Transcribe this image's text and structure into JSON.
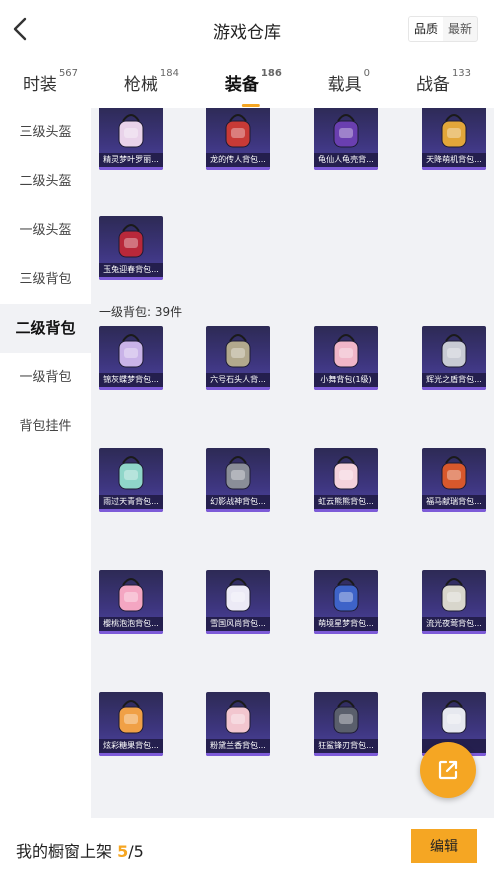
{
  "header": {
    "title": "游戏仓库",
    "sort_options": [
      "品质",
      "最新"
    ],
    "sort_active": 0
  },
  "categories": [
    {
      "label": "时装",
      "count": "567",
      "active": false
    },
    {
      "label": "枪械",
      "count": "184",
      "active": false
    },
    {
      "label": "装备",
      "count": "186",
      "active": true
    },
    {
      "label": "载具",
      "count": "0",
      "active": false
    },
    {
      "label": "战备",
      "count": "133",
      "active": false
    }
  ],
  "sidebar": {
    "items": [
      {
        "label": "三级头盔",
        "active": false
      },
      {
        "label": "二级头盔",
        "active": false
      },
      {
        "label": "一级头盔",
        "active": false
      },
      {
        "label": "三级背包",
        "active": false
      },
      {
        "label": "二级背包",
        "active": true
      },
      {
        "label": "一级背包",
        "active": false
      },
      {
        "label": "背包挂件",
        "active": false
      }
    ]
  },
  "sections": {
    "level2_items": [
      {
        "name": "精灵梦叶罗丽...",
        "icon": "pink-backpack-icon",
        "color": "#e9d3ea"
      },
      {
        "name": "龙的传人背包...",
        "icon": "red-backpack-icon",
        "color": "#c83a36"
      },
      {
        "name": "龟仙人龟壳背...",
        "icon": "purple-shell-backpack-icon",
        "color": "#6a3fb0"
      },
      {
        "name": "天降萌机背包...",
        "icon": "gold-backpack-icon",
        "color": "#e2a63a"
      },
      {
        "name": "玉兔迎春背包...",
        "icon": "red-white-backpack-icon",
        "color": "#b8283a"
      }
    ],
    "level1_label": "一级背包: 39件",
    "level1_items": [
      {
        "name": "锦灰蝶梦背包...",
        "icon": "gem-pouch-icon",
        "color": "#c9b3e8"
      },
      {
        "name": "六号石头人背...",
        "icon": "stone-pouch-icon",
        "color": "#b2a98d"
      },
      {
        "name": "小舞背包(1级)",
        "icon": "bunny-pouch-icon",
        "color": "#f0b6c8"
      },
      {
        "name": "辉光之盾背包...",
        "icon": "shield-pouch-icon",
        "color": "#c8cbd4"
      },
      {
        "name": "雨过天青背包...",
        "icon": "teal-pouch-icon",
        "color": "#8fd6c9"
      },
      {
        "name": "幻影战神背包...",
        "icon": "grey-backpack-icon",
        "color": "#8a8e98"
      },
      {
        "name": "虹云熊熊背包...",
        "icon": "cloud-bear-pouch-icon",
        "color": "#f4d2dc"
      },
      {
        "name": "福马献瑞背包...",
        "icon": "horse-pouch-icon",
        "color": "#d8582c"
      },
      {
        "name": "樱桃泡泡背包...",
        "icon": "cherry-pouch-icon",
        "color": "#f4a6c2"
      },
      {
        "name": "雪国风尚背包...",
        "icon": "snow-bunny-pouch-icon",
        "color": "#eceaf6"
      },
      {
        "name": "萌境星梦背包...",
        "icon": "star-pouch-icon",
        "color": "#3e63c8"
      },
      {
        "name": "流光夜莺背包...",
        "icon": "nightingale-pouch-icon",
        "color": "#d8d6cc"
      },
      {
        "name": "炫彩糖果背包...",
        "icon": "donut-pouch-icon",
        "color": "#f0a046"
      },
      {
        "name": "粉黛兰香背包...",
        "icon": "pink-bunny-pouch-icon",
        "color": "#f2c6cf"
      },
      {
        "name": "狂鲨锋刃背包...",
        "icon": "shark-pouch-icon",
        "color": "#5a5f6c"
      },
      {
        "name": "",
        "icon": "white-pouch-icon",
        "color": "#e6e8ef"
      }
    ]
  },
  "bottom": {
    "label": "我的橱窗上架 ",
    "count_current": "5",
    "count_sep": "/",
    "count_total": "5",
    "edit_label": "编辑"
  },
  "fab_icon": "share-external-icon",
  "colors": {
    "accent": "#f5a623",
    "card_bg": "#3e3680",
    "content_bg": "#f1f2f5"
  }
}
